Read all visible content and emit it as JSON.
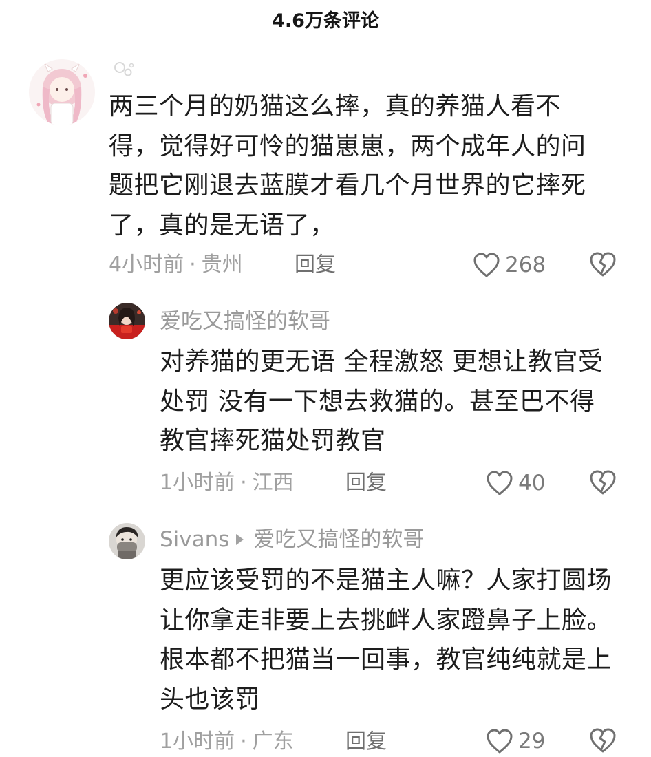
{
  "header": {
    "title": "4.6万条评论"
  },
  "comments": [
    {
      "text": "两三个月的奶猫这么摔，真的养猫人看不得，觉得好可怜的猫崽崽，两个成年人的问题把它刚退去蓝膜才看几个月世界的它摔死了，真的是无语了，",
      "time": "4小时前",
      "location": "贵州",
      "reply_label": "回复",
      "likes": "268"
    },
    {
      "username": "爱吃又搞怪的软哥",
      "text": "对养猫的更无语 全程激怒 更想让教官受处罚 没有一下想去救猫的。甚至巴不得教官摔死猫处罚教官",
      "time": "1小时前",
      "location": "江西",
      "reply_label": "回复",
      "likes": "40"
    },
    {
      "username": "Sivans",
      "reply_to": "爱吃又搞怪的软哥",
      "text": "更应该受罚的不是猫主人嘛？人家打圆场让你拿走非要上去挑衅人家蹬鼻子上脸。根本都不把猫当一回事，教官纯纯就是上头也该罚",
      "time": "1小时前",
      "location": "广东",
      "reply_label": "回复",
      "likes": "29"
    }
  ],
  "separator": "·",
  "icons": {
    "like": "heart-outline-icon",
    "dislike": "broken-heart-icon"
  },
  "colors": {
    "text": "#1d1d1d",
    "meta": "#a0a0a0",
    "reply": "#6f6f6f",
    "icon": "#707070"
  }
}
